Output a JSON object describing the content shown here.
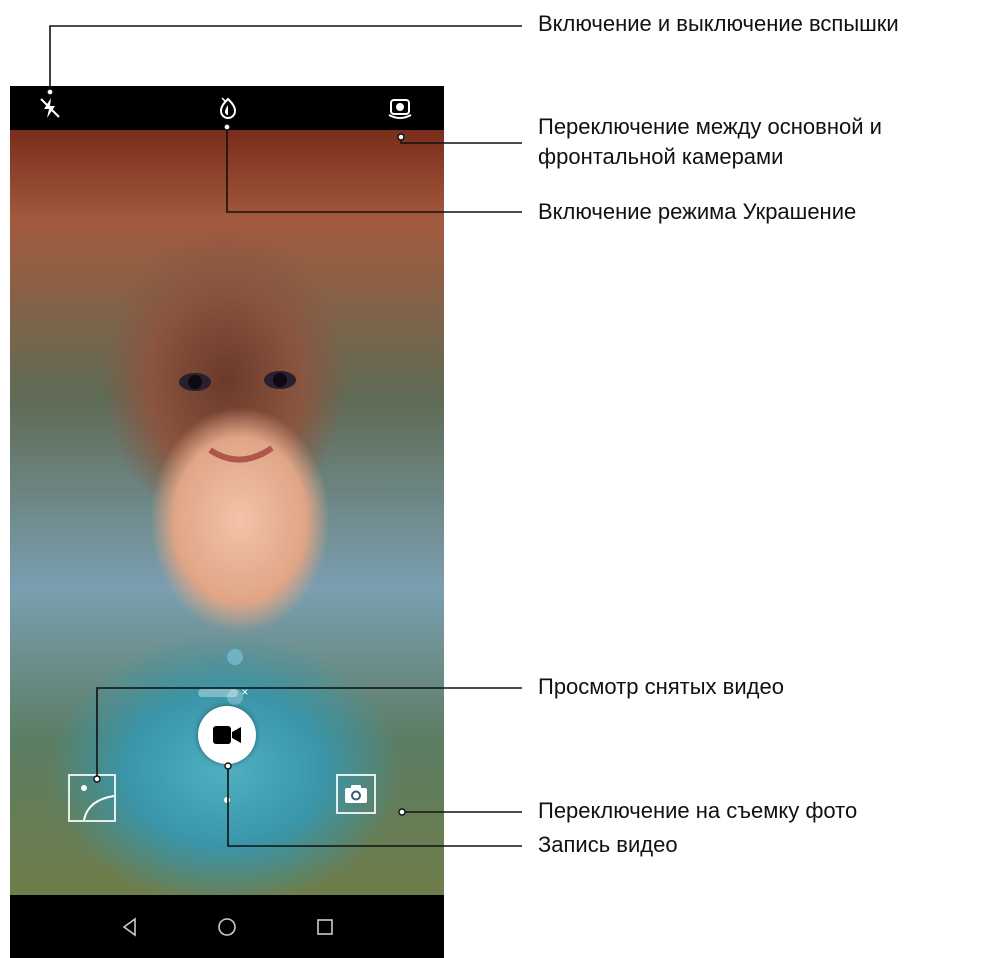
{
  "camera": {
    "mode": "video",
    "flash_state": "off",
    "zoom_indicator_close": "×"
  },
  "annotations": {
    "flash": "Включение и выключение вспышки",
    "switch_camera_line1": "Переключение между основной и",
    "switch_camera_line2": "фронтальной камерами",
    "beauty": "Включение режима Украшение",
    "gallery": "Просмотр снятых видео",
    "photo_mode": "Переключение на съемку фото",
    "record": "Запись видео"
  },
  "colors": {
    "callout_line": "#111111",
    "bar_bg": "#000000",
    "shutter_icon": "#000000"
  },
  "icons": [
    "flash-off-icon",
    "beauty-icon",
    "camera-switch-icon",
    "gallery-thumbnail",
    "video-camera-icon",
    "photo-camera-icon",
    "back-icon",
    "home-icon",
    "recents-icon"
  ]
}
